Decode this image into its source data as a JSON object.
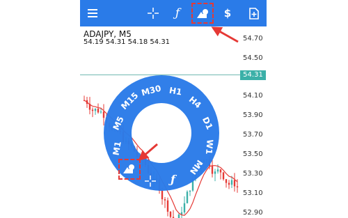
{
  "toolbar": {
    "buttons": [
      {
        "name": "menu",
        "icon": "menu-icon"
      },
      {
        "name": "crosshair",
        "icon": "crosshair-icon"
      },
      {
        "name": "indicators",
        "icon": "function-icon",
        "label": "ƒ"
      },
      {
        "name": "objects",
        "icon": "shapes-icon"
      },
      {
        "name": "trade",
        "icon": "dollar-trade-icon",
        "label": "$"
      },
      {
        "name": "new-order",
        "icon": "add-document-icon"
      }
    ]
  },
  "chart": {
    "symbol_line": "ADAJPY, M5",
    "ohlc_line": "54.19 54.31 54.18 54.31",
    "current_price": "54.31",
    "price_ticks": [
      "54.70",
      "54.50",
      "54.10",
      "53.90",
      "53.70",
      "53.50",
      "53.30",
      "53.10",
      "52.90"
    ]
  },
  "wheel": {
    "timeframes": [
      "M1",
      "M5",
      "M15",
      "M30",
      "H1",
      "H4",
      "D1",
      "W1",
      "MN"
    ],
    "bottom": {
      "crosshair": "crosshair-icon",
      "function": "ƒ",
      "objects": "shapes-icon"
    }
  },
  "colors": {
    "accent": "#2a7be8",
    "bull": "#3bb0a8",
    "bear": "#e53935"
  }
}
